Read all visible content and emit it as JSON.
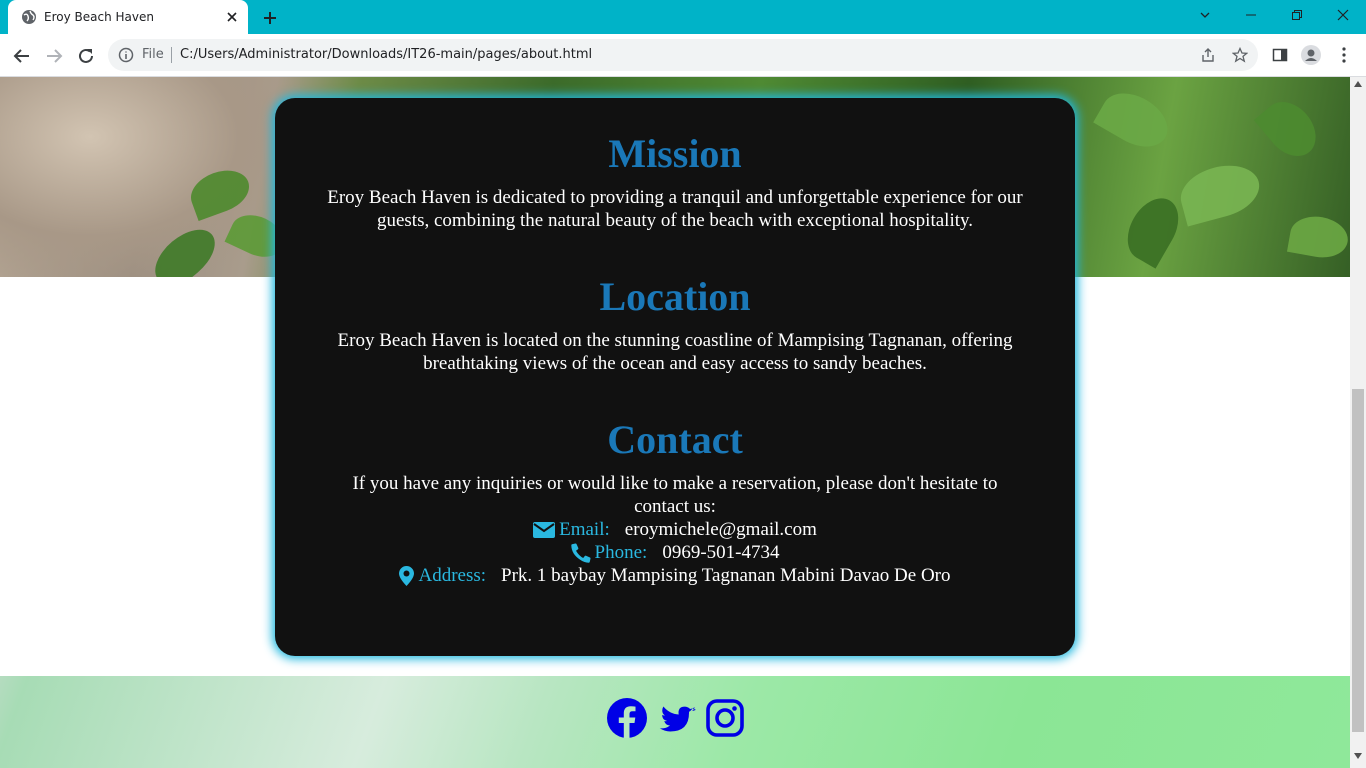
{
  "browser": {
    "tab_title": "Eroy Beach Haven",
    "url_scheme_label": "File",
    "url": "C:/Users/Administrator/Downloads/IT26-main/pages/about.html"
  },
  "mission": {
    "heading": "Mission",
    "text_line1": "Eroy Beach Haven is dedicated to providing a tranquil and unforgettable experience for our",
    "text_line2": "guests, combining the natural beauty of the beach with exceptional hospitality."
  },
  "location": {
    "heading": "Location",
    "text_line1": "Eroy Beach Haven is located on the stunning coastline of Mampising Tagnanan, offering",
    "text_line2": "breathtaking views of the ocean and easy access to sandy beaches."
  },
  "contact": {
    "heading": "Contact",
    "intro_line1": "If you have any inquiries or would like to make a reservation, please don't hesitate to",
    "intro_line2": "contact us:",
    "email_label": "Email:",
    "email_value": "eroymichele@gmail.com",
    "phone_label": "Phone:",
    "phone_value": "0969-501-4734",
    "address_label": "Address:",
    "address_value": "Prk. 1 baybay Mampising Tagnanan Mabini Davao De Oro"
  },
  "footer": {
    "social_icons": [
      "facebook-icon",
      "twitter-icon",
      "instagram-icon"
    ]
  },
  "colors": {
    "tabstrip": "#00b3c8",
    "card_bg": "#111111",
    "card_glow": "#21b8df",
    "heading": "#1a78b8",
    "contact_label": "#2ab8e0",
    "social_icon": "#0000e6"
  }
}
